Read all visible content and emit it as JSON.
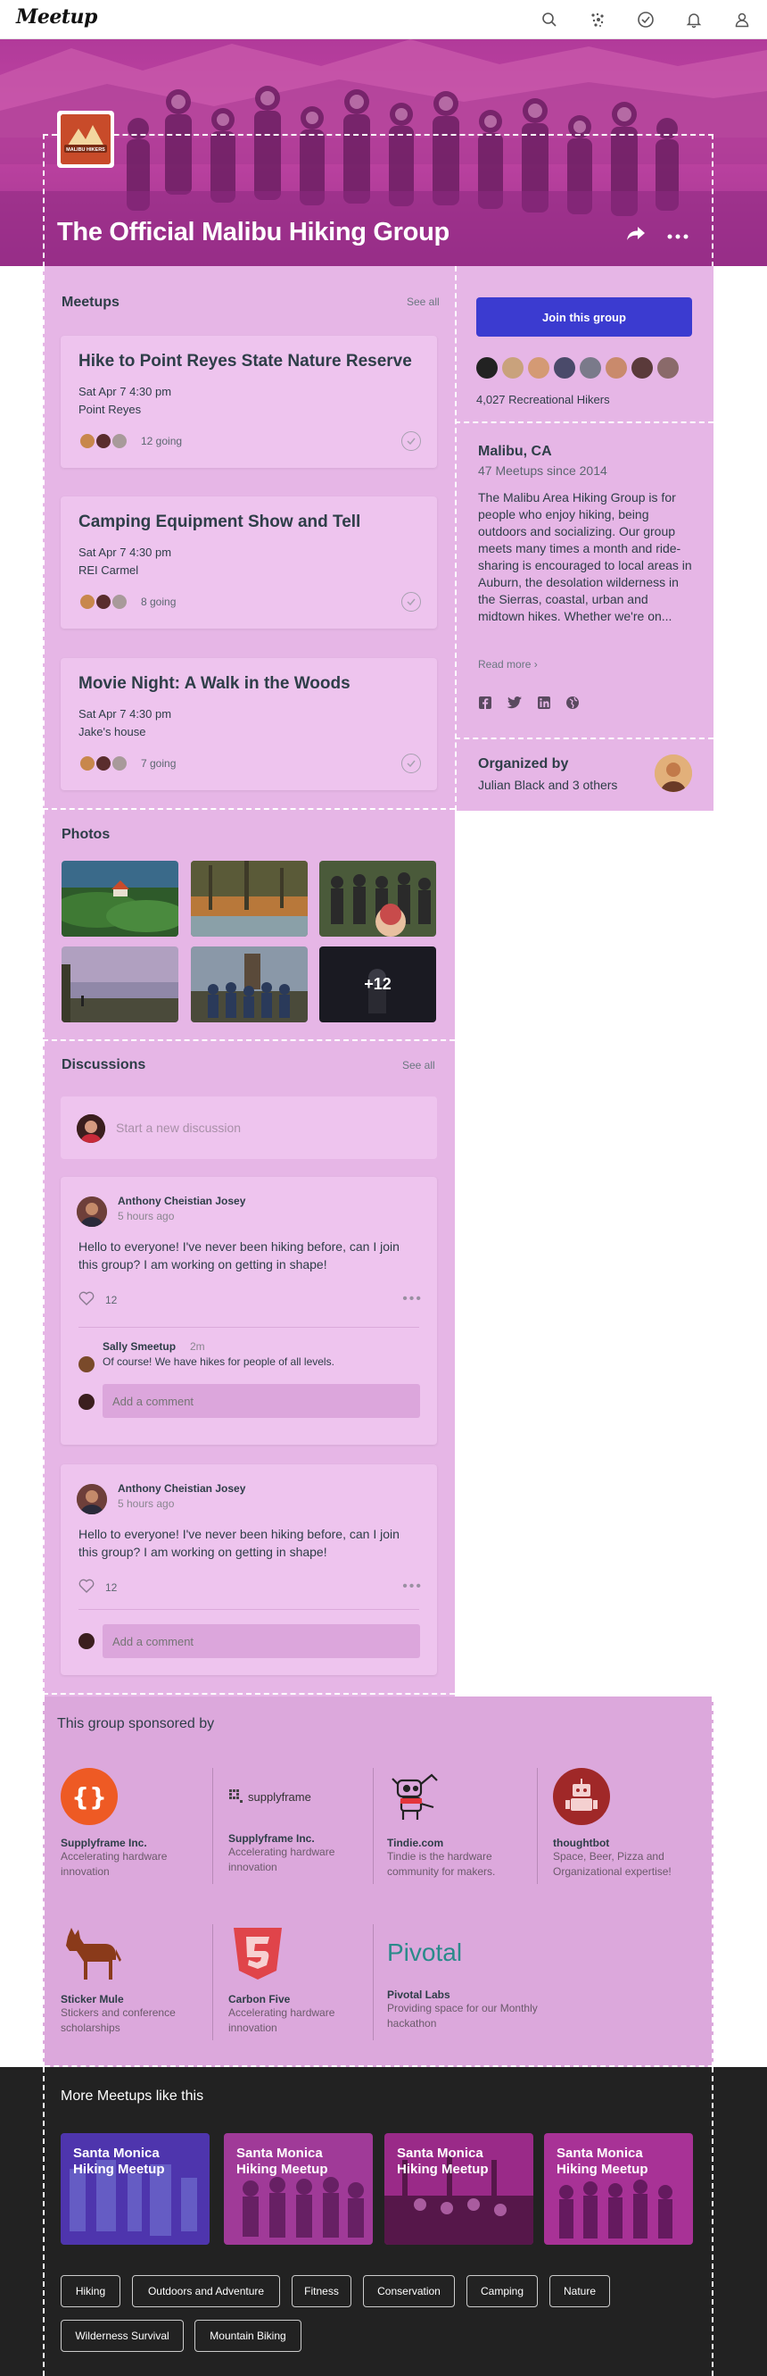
{
  "nav": {
    "logo": "Meetup",
    "icons": [
      "search-icon",
      "explore-icon",
      "calendar-check-icon",
      "notifications-icon",
      "profile-icon"
    ]
  },
  "hero": {
    "title": "The Official Malibu Hiking Group",
    "logo_text": "MALIBU HIKERS",
    "actions": [
      "share-icon",
      "more-icon"
    ]
  },
  "meetups": {
    "title": "Meetups",
    "see_all": "See all",
    "events": [
      {
        "title": "Hike to Point Reyes State Nature Reserve",
        "date": "Sat Apr 7  4:30 pm",
        "place": "Point Reyes",
        "going": "12 going"
      },
      {
        "title": "Camping Equipment Show and Tell",
        "date": "Sat Apr 7  4:30 pm",
        "place": "REI Carmel",
        "going": "8 going"
      },
      {
        "title": "Movie Night: A Walk in the Woods",
        "date": "Sat Apr 7  4:30 pm",
        "place": "Jake's house",
        "going": "7 going"
      }
    ]
  },
  "side": {
    "join": "Join this group",
    "members": "4,027 Recreational Hikers",
    "location": "Malibu, CA",
    "since": "47 Meetups since 2014",
    "description": "The Malibu Area Hiking Group is for people who enjoy hiking, being outdoors and socializing. Our group meets many times a month and ride-sharing is encouraged  to local areas in Auburn, the desolation wilderness in the Sierras, coastal, urban and midtown hikes. Whether we're on...",
    "read_more": "Read more ›",
    "socials": [
      "facebook-icon",
      "twitter-icon",
      "linkedin-icon",
      "website-icon"
    ],
    "organized_by": "Organized by",
    "organizers": "Julian Black and 3 others"
  },
  "photos": {
    "title": "Photos",
    "more_count": "+12"
  },
  "discussions": {
    "title": "Discussions",
    "see_all": "See all",
    "new_placeholder": "Start a new discussion",
    "posts": [
      {
        "author": "Anthony Cheistian Josey",
        "ago": "5 hours ago",
        "text": "Hello to everyone! I've never been hiking before, can I join this group?  I am working on getting in shape!",
        "likes": "12",
        "reply": {
          "name": "Sally Smeetup",
          "time": "2m",
          "text": "Of course! We have hikes for people of all levels."
        },
        "comment_placeholder": "Add a comment"
      },
      {
        "author": "Anthony Cheistian Josey",
        "ago": "5 hours ago",
        "text": "Hello to everyone! I've never been hiking before, can I join this group?  I am working on getting in shape!",
        "likes": "12",
        "comment_placeholder": "Add a comment"
      }
    ]
  },
  "sponsors": {
    "title": "This group sponsored by",
    "items": [
      {
        "name": "Supplyframe Inc.",
        "desc": "Accelerating hardware innovation",
        "logo": "braces-logo"
      },
      {
        "name": "Supplyframe Inc.",
        "desc": "Accelerating hardware innovation",
        "logo": "supplyframe-logo",
        "logo_text": "supplyframe"
      },
      {
        "name": "Tindie.com",
        "desc": "Tindie is the hardware community for makers.",
        "logo": "robot-dog-logo"
      },
      {
        "name": "thoughtbot",
        "desc": "Space, Beer, Pizza and Organizational expertise!",
        "logo": "robot-logo"
      },
      {
        "name": "Sticker Mule",
        "desc": "Stickers and conference scholarships",
        "logo": "mule-logo"
      },
      {
        "name": "Carbon Five",
        "desc": "Accelerating hardware innovation",
        "logo": "carbon-five-logo"
      },
      {
        "name": "Pivotal Labs",
        "desc": "Providing space for our Monthly hackathon",
        "logo": "pivotal-logo",
        "logo_text": "Pivotal"
      }
    ]
  },
  "more": {
    "title": "More Meetups like this",
    "cards": [
      {
        "label": "Santa Monica Hiking Meetup"
      },
      {
        "label": "Santa Monica Hiking Meetup"
      },
      {
        "label": "Santa Monica Hiking Meetup"
      },
      {
        "label": "Santa Monica Hiking Meetup"
      }
    ],
    "tags": [
      "Hiking",
      "Outdoors and Adventure",
      "Fitness",
      "Conservation",
      "Camping",
      "Nature",
      "Wilderness Survival",
      "Mountain Biking"
    ]
  },
  "colors": {
    "accent": "#3b3bd0",
    "panel": "#e6b6e6",
    "card": "#eec4ee",
    "footer": "#222222"
  }
}
